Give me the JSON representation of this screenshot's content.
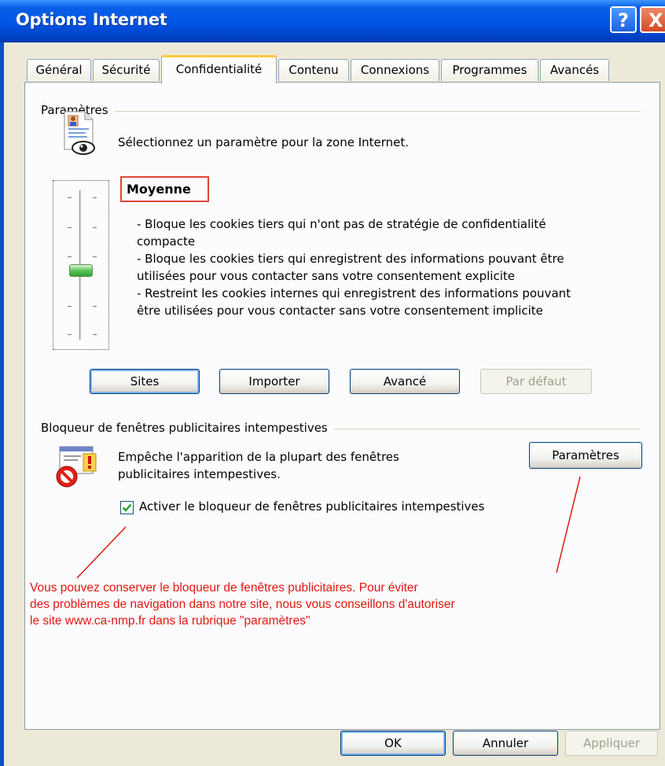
{
  "window": {
    "title": "Options Internet",
    "help_glyph": "?",
    "close_glyph": "X"
  },
  "tabs": [
    {
      "label": "Général"
    },
    {
      "label": "Sécurité"
    },
    {
      "label": "Confidentialité",
      "active": true
    },
    {
      "label": "Contenu"
    },
    {
      "label": "Connexions"
    },
    {
      "label": "Programmes"
    },
    {
      "label": "Avancés"
    }
  ],
  "settings": {
    "group_label": "Paramètres",
    "instruction": "Sélectionnez un paramètre pour la zone Internet.",
    "icon": "privacy-report-icon",
    "slider_level": 0.5,
    "level_name": "Moyenne",
    "description_lines": [
      "- Bloque les cookies tiers qui n'ont pas de stratégie de confidentialité",
      "compacte",
      "- Bloque les cookies tiers qui enregistrent des informations pouvant être",
      "utilisées pour vous contacter sans votre consentement explicite",
      "- Restreint les cookies internes qui enregistrent des informations pouvant",
      "être utilisées pour vous contacter sans votre consentement implicite"
    ],
    "buttons": {
      "sites": "Sites",
      "import": "Importer",
      "advanced": "Avancé",
      "default": "Par défaut"
    }
  },
  "popup_blocker": {
    "group_label": "Bloqueur de fenêtres publicitaires intempestives",
    "icon": "popup-blocked-icon",
    "description_line1": "Empêche l'apparition de la plupart des fenêtres",
    "description_line2": "publicitaires intempestives.",
    "settings_button": "Paramètres",
    "checkbox_label": "Activer le bloqueur de fenêtres publicitaires intempestives",
    "checkbox_checked": true
  },
  "annotation": {
    "lines": [
      "Vous pouvez conserver le bloqueur de fenêtres publicitaires. Pour éviter",
      "des problèmes de navigation dans notre site, nous vous conseillons d'autoriser",
      "le site www.ca-nmp.fr dans la rubrique \"paramètres\""
    ],
    "color": "#e0170f"
  },
  "footer": {
    "ok": "OK",
    "cancel": "Annuler",
    "apply": "Appliquer"
  },
  "colors": {
    "titlebar": "#0055e5",
    "dialog_bg": "#ece9d8",
    "panel_bg": "#fcfcfe",
    "tab_highlight": "#ffc83c",
    "level_box_border": "#e0433a"
  }
}
